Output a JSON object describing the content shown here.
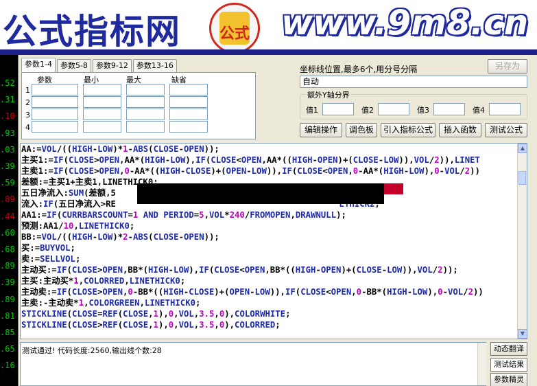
{
  "banner": {
    "title": "公式指标网",
    "logo_text": "公式",
    "url": "www.9m8.cn"
  },
  "price_axis": [
    {
      "label": ".52",
      "color": "#00cc00"
    },
    {
      "label": ".31",
      "color": "#00cc00"
    },
    {
      "label": ".10",
      "color": "#cc0000"
    },
    {
      "label": ".93",
      "color": "#00cc00"
    },
    {
      "label": ".03",
      "color": "#00cc00"
    },
    {
      "label": ".39",
      "color": "#00cc00"
    },
    {
      "label": ".59",
      "color": "#00cc00"
    },
    {
      "label": ".89",
      "color": "#cc0000"
    },
    {
      "label": ".44",
      "color": "#cc0000"
    },
    {
      "label": ".60",
      "color": "#00cc00"
    },
    {
      "label": ".68",
      "color": "#00cc00"
    },
    {
      "label": ".89",
      "color": "#00cc00"
    },
    {
      "label": ".39",
      "color": "#00cc00"
    },
    {
      "label": ".89",
      "color": "#00cc00"
    },
    {
      "label": ".81",
      "color": "#00cc00"
    },
    {
      "label": ".85",
      "color": "#00cc00"
    },
    {
      "label": ".65",
      "color": "#00cc00"
    },
    {
      "label": ".16",
      "color": "#00cc00"
    }
  ],
  "tabs": [
    "参数1-4",
    "参数5-8",
    "参数9-12",
    "参数13-16"
  ],
  "params": {
    "headers": [
      "参数",
      "最小",
      "最大",
      "缺省"
    ],
    "rows": [
      "1",
      "2",
      "3",
      "4"
    ]
  },
  "axis": {
    "label": "坐标线位置,最多6个,用分号分隔",
    "value": "自动",
    "save_as": "另存为"
  },
  "yaxis": {
    "legend": "额外Y轴分界",
    "labels": [
      "值1",
      "值2",
      "值3",
      "值4"
    ]
  },
  "actions": [
    "编辑操作",
    "调色板",
    "引入指标公式",
    "插入函数",
    "测试公式"
  ],
  "code_lines": [
    [
      [
        "t",
        "AA:="
      ],
      [
        "k",
        "VOL"
      ],
      [
        "t",
        "/(("
      ],
      [
        "k",
        "HIGH"
      ],
      [
        "t",
        "-"
      ],
      [
        "k",
        "LOW"
      ],
      [
        "t",
        ")*"
      ],
      [
        "n",
        "1"
      ],
      [
        "t",
        "-"
      ],
      [
        "k",
        "ABS"
      ],
      [
        "t",
        "("
      ],
      [
        "k",
        "CLOSE"
      ],
      [
        "t",
        "-"
      ],
      [
        "k",
        "OPEN"
      ],
      [
        "t",
        "));"
      ]
    ],
    [
      [
        "t",
        "主买1:="
      ],
      [
        "k",
        "IF"
      ],
      [
        "t",
        "("
      ],
      [
        "k",
        "CLOSE"
      ],
      [
        "t",
        ">"
      ],
      [
        "k",
        "OPEN"
      ],
      [
        "t",
        ",AA*("
      ],
      [
        "k",
        "HIGH"
      ],
      [
        "t",
        "-"
      ],
      [
        "k",
        "LOW"
      ],
      [
        "t",
        "),"
      ],
      [
        "k",
        "IF"
      ],
      [
        "t",
        "("
      ],
      [
        "k",
        "CLOSE"
      ],
      [
        "t",
        "<"
      ],
      [
        "k",
        "OPEN"
      ],
      [
        "t",
        ",AA*(("
      ],
      [
        "k",
        "HIGH"
      ],
      [
        "t",
        "-"
      ],
      [
        "k",
        "OPEN"
      ],
      [
        "t",
        ")+("
      ],
      [
        "k",
        "CLOSE"
      ],
      [
        "t",
        "-"
      ],
      [
        "k",
        "LOW"
      ],
      [
        "t",
        ")),"
      ],
      [
        "k",
        "VOL"
      ],
      [
        "t",
        "/"
      ],
      [
        "n",
        "2"
      ],
      [
        "t",
        ")),"
      ],
      [
        "k",
        "LINET"
      ]
    ],
    [
      [
        "t",
        "主卖1:="
      ],
      [
        "k",
        "IF"
      ],
      [
        "t",
        "("
      ],
      [
        "k",
        "CLOSE"
      ],
      [
        "t",
        ">"
      ],
      [
        "k",
        "OPEN"
      ],
      [
        "t",
        ","
      ],
      [
        "n",
        "0"
      ],
      [
        "t",
        "-AA*(("
      ],
      [
        "k",
        "HIGH"
      ],
      [
        "t",
        "-"
      ],
      [
        "k",
        "CLOSE"
      ],
      [
        "t",
        ")+("
      ],
      [
        "k",
        "OPEN"
      ],
      [
        "t",
        "-"
      ],
      [
        "k",
        "LOW"
      ],
      [
        "t",
        ")),"
      ],
      [
        "k",
        "IF"
      ],
      [
        "t",
        "("
      ],
      [
        "k",
        "CLOSE"
      ],
      [
        "t",
        "<"
      ],
      [
        "k",
        "OPEN"
      ],
      [
        "t",
        ","
      ],
      [
        "n",
        "0"
      ],
      [
        "t",
        "-AA*("
      ],
      [
        "k",
        "HIGH"
      ],
      [
        "t",
        "-"
      ],
      [
        "k",
        "LOW"
      ],
      [
        "t",
        "),"
      ],
      [
        "n",
        "0"
      ],
      [
        "t",
        "-"
      ],
      [
        "k",
        "VOL"
      ],
      [
        "t",
        "/"
      ],
      [
        "n",
        "2"
      ],
      [
        "t",
        "))"
      ]
    ],
    [
      [
        "t",
        "差额:=主买1+主卖1,LINETHICK0;"
      ]
    ],
    [
      [
        "t",
        "五日净流入:"
      ],
      [
        "k",
        "SUM"
      ],
      [
        "t",
        "(差额,5"
      ]
    ],
    [
      [
        "t",
        "流入:"
      ],
      [
        "k",
        "IF"
      ],
      [
        "t",
        "(五日净流入>RE"
      ],
      [
        "t",
        "                                            "
      ],
      [
        "k",
        "ETHICK2"
      ],
      [
        "t",
        ";"
      ]
    ],
    [
      [
        "t",
        "AA1:="
      ],
      [
        "k",
        "IF"
      ],
      [
        "t",
        "("
      ],
      [
        "k",
        "CURRBARSCOUNT"
      ],
      [
        "t",
        "="
      ],
      [
        "n",
        "1"
      ],
      [
        "t",
        " "
      ],
      [
        "k",
        "AND"
      ],
      [
        "t",
        " "
      ],
      [
        "k",
        "PERIOD"
      ],
      [
        "t",
        "="
      ],
      [
        "n",
        "5"
      ],
      [
        "t",
        ","
      ],
      [
        "k",
        "VOL"
      ],
      [
        "t",
        "*"
      ],
      [
        "n",
        "240"
      ],
      [
        "t",
        "/"
      ],
      [
        "k",
        "FROMOPEN"
      ],
      [
        "t",
        ","
      ],
      [
        "k",
        "DRAWNULL"
      ],
      [
        "t",
        ");"
      ]
    ],
    [
      [
        "t",
        "预测:AA1/"
      ],
      [
        "n",
        "10"
      ],
      [
        "t",
        ","
      ],
      [
        "k",
        "LINETHICK0"
      ],
      [
        "t",
        ";"
      ]
    ],
    [
      [
        "t",
        "BB:="
      ],
      [
        "k",
        "VOL"
      ],
      [
        "t",
        "/(("
      ],
      [
        "k",
        "HIGH"
      ],
      [
        "t",
        "-"
      ],
      [
        "k",
        "LOW"
      ],
      [
        "t",
        ")*"
      ],
      [
        "n",
        "2"
      ],
      [
        "t",
        "-"
      ],
      [
        "k",
        "ABS"
      ],
      [
        "t",
        "("
      ],
      [
        "k",
        "CLOSE"
      ],
      [
        "t",
        "-"
      ],
      [
        "k",
        "OPEN"
      ],
      [
        "t",
        "));"
      ]
    ],
    [
      [
        "t",
        "买:="
      ],
      [
        "k",
        "BUYVOL"
      ],
      [
        "t",
        ";"
      ]
    ],
    [
      [
        "t",
        "卖:="
      ],
      [
        "k",
        "SELLVOL"
      ],
      [
        "t",
        ";"
      ]
    ],
    [
      [
        "t",
        "主动买:="
      ],
      [
        "k",
        "IF"
      ],
      [
        "t",
        "("
      ],
      [
        "k",
        "CLOSE"
      ],
      [
        "t",
        ">"
      ],
      [
        "k",
        "OPEN"
      ],
      [
        "t",
        ",BB*("
      ],
      [
        "k",
        "HIGH"
      ],
      [
        "t",
        "-"
      ],
      [
        "k",
        "LOW"
      ],
      [
        "t",
        "),"
      ],
      [
        "k",
        "IF"
      ],
      [
        "t",
        "("
      ],
      [
        "k",
        "CLOSE"
      ],
      [
        "t",
        "<"
      ],
      [
        "k",
        "OPEN"
      ],
      [
        "t",
        ",BB*(("
      ],
      [
        "k",
        "HIGH"
      ],
      [
        "t",
        "-"
      ],
      [
        "k",
        "OPEN"
      ],
      [
        "t",
        ")+("
      ],
      [
        "k",
        "CLOSE"
      ],
      [
        "t",
        "-"
      ],
      [
        "k",
        "LOW"
      ],
      [
        "t",
        ")),"
      ],
      [
        "k",
        "VOL"
      ],
      [
        "t",
        "/"
      ],
      [
        "n",
        "2"
      ],
      [
        "t",
        "));"
      ]
    ],
    [
      [
        "t",
        "主买:主动买*"
      ],
      [
        "n",
        "1"
      ],
      [
        "t",
        ","
      ],
      [
        "k",
        "COLORRED"
      ],
      [
        "t",
        ","
      ],
      [
        "k",
        "LINETHICK0"
      ],
      [
        "t",
        ";"
      ]
    ],
    [
      [
        "t",
        "主动卖:="
      ],
      [
        "k",
        "IF"
      ],
      [
        "t",
        "("
      ],
      [
        "k",
        "CLOSE"
      ],
      [
        "t",
        ">"
      ],
      [
        "k",
        "OPEN"
      ],
      [
        "t",
        ","
      ],
      [
        "n",
        "0"
      ],
      [
        "t",
        "-BB*(("
      ],
      [
        "k",
        "HIGH"
      ],
      [
        "t",
        "-"
      ],
      [
        "k",
        "CLOSE"
      ],
      [
        "t",
        ")+("
      ],
      [
        "k",
        "OPEN"
      ],
      [
        "t",
        "-"
      ],
      [
        "k",
        "LOW"
      ],
      [
        "t",
        ")),"
      ],
      [
        "k",
        "IF"
      ],
      [
        "t",
        "("
      ],
      [
        "k",
        "CLOSE"
      ],
      [
        "t",
        "<"
      ],
      [
        "k",
        "OPEN"
      ],
      [
        "t",
        ","
      ],
      [
        "n",
        "0"
      ],
      [
        "t",
        "-BB*("
      ],
      [
        "k",
        "HIGH"
      ],
      [
        "t",
        "-"
      ],
      [
        "k",
        "LOW"
      ],
      [
        "t",
        "),"
      ],
      [
        "n",
        "0"
      ],
      [
        "t",
        "-"
      ],
      [
        "k",
        "VOL"
      ],
      [
        "t",
        "/"
      ],
      [
        "n",
        "2"
      ],
      [
        "t",
        "))"
      ]
    ],
    [
      [
        "t",
        "主卖:-主动卖*"
      ],
      [
        "n",
        "1"
      ],
      [
        "t",
        ","
      ],
      [
        "k",
        "COLORGREEN"
      ],
      [
        "t",
        ","
      ],
      [
        "k",
        "LINETHICK0"
      ],
      [
        "t",
        ";"
      ]
    ],
    [
      [
        "k",
        "STICKLINE"
      ],
      [
        "t",
        "("
      ],
      [
        "k",
        "CLOSE"
      ],
      [
        "t",
        "="
      ],
      [
        "k",
        "REF"
      ],
      [
        "t",
        "("
      ],
      [
        "k",
        "CLOSE"
      ],
      [
        "t",
        ","
      ],
      [
        "n",
        "1"
      ],
      [
        "t",
        "),"
      ],
      [
        "n",
        "0"
      ],
      [
        "t",
        ","
      ],
      [
        "k",
        "VOL"
      ],
      [
        "t",
        ","
      ],
      [
        "n",
        "3.5"
      ],
      [
        "t",
        ","
      ],
      [
        "n",
        "0"
      ],
      [
        "t",
        "),"
      ],
      [
        "k",
        "COLORWHITE"
      ],
      [
        "t",
        ";"
      ]
    ],
    [
      [
        "k",
        "STICKLINE"
      ],
      [
        "t",
        "("
      ],
      [
        "k",
        "CLOSE"
      ],
      [
        "t",
        ">"
      ],
      [
        "k",
        "REF"
      ],
      [
        "t",
        "("
      ],
      [
        "k",
        "CLOSE"
      ],
      [
        "t",
        ","
      ],
      [
        "n",
        "1"
      ],
      [
        "t",
        "),"
      ],
      [
        "n",
        "0"
      ],
      [
        "t",
        ","
      ],
      [
        "k",
        "VOL"
      ],
      [
        "t",
        ","
      ],
      [
        "n",
        "3.5"
      ],
      [
        "t",
        ","
      ],
      [
        "n",
        "0"
      ],
      [
        "t",
        "),"
      ],
      [
        "k",
        "COLORRED"
      ],
      [
        "t",
        ";"
      ]
    ]
  ],
  "result_text": "测试通过! 代码长度:2560,输出线个数:28",
  "side_buttons": [
    "动态翻译",
    "测试结果",
    "参数精灵"
  ]
}
